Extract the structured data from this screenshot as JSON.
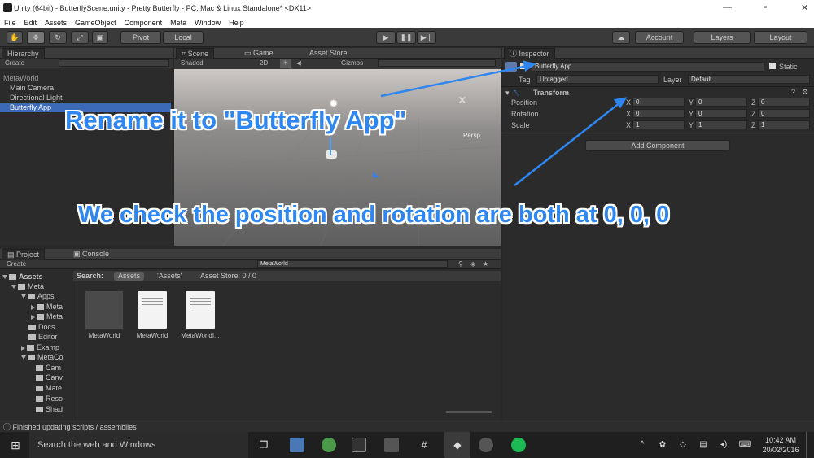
{
  "window": {
    "title": "Unity (64bit) - ButterflyScene.unity - Pretty Butterfly - PC, Mac & Linux Standalone* <DX11>"
  },
  "menu": [
    "File",
    "Edit",
    "Assets",
    "GameObject",
    "Component",
    "Meta",
    "Window",
    "Help"
  ],
  "toolbar": {
    "pivot": "Pivot",
    "local": "Local",
    "account": "Account",
    "layers": "Layers",
    "layout": "Layout"
  },
  "hierarchy": {
    "tab": "Hierarchy",
    "create": "Create",
    "items": [
      {
        "label": "MetaWorld",
        "selected": false
      },
      {
        "label": "Main Camera",
        "selected": false
      },
      {
        "label": "Directional Light",
        "selected": false
      },
      {
        "label": "Butterfly App",
        "selected": true
      }
    ]
  },
  "scene": {
    "tab": "Scene",
    "game_tab": "Game",
    "store_tab": "Asset Store",
    "shaded": "Shaded",
    "mode2d": "2D",
    "gizmos": "Gizmos",
    "persp": "Persp"
  },
  "inspector": {
    "tab": "Inspector",
    "object_name": "Butterfly App",
    "static": "Static",
    "tag_label": "Tag",
    "tag_value": "Untagged",
    "layer_label": "Layer",
    "layer_value": "Default",
    "component": "Transform",
    "rows": [
      {
        "label": "Position",
        "x": "0",
        "y": "0",
        "z": "0"
      },
      {
        "label": "Rotation",
        "x": "0",
        "y": "0",
        "z": "0"
      },
      {
        "label": "Scale",
        "x": "1",
        "y": "1",
        "z": "1"
      }
    ],
    "add_component": "Add Component"
  },
  "project": {
    "tab": "Project",
    "console_tab": "Console",
    "create": "Create",
    "search_value": "MetaWorld",
    "search_label": "Search:",
    "scope_assets": "Assets",
    "scope_quoted": "'Assets'",
    "asset_store": "Asset Store: 0 / 0",
    "tree": [
      "Assets",
      "Meta",
      "Apps",
      "Meta",
      "Meta",
      "Docs",
      "Editor",
      "Examp",
      "MetaCo",
      "Cam",
      "Canv",
      "Mate",
      "Reso",
      "Shad"
    ],
    "assets": [
      {
        "name": "MetaWorld",
        "type": "folder"
      },
      {
        "name": "MetaWorld",
        "type": "doc"
      },
      {
        "name": "MetaWorldI...",
        "type": "doc"
      }
    ]
  },
  "annotations": {
    "rename": "Rename it to \"Butterfly App\"",
    "check": "We check the position and rotation are both at 0, 0, 0"
  },
  "status": "Finished updating scripts / assemblies",
  "taskbar": {
    "search": "Search the web and Windows",
    "time": "10:42 AM",
    "date": "20/02/2016"
  },
  "colors": {
    "accent": "#2e86f0",
    "selection": "#3d6ab8",
    "scene_sky": "#c9c4c0"
  }
}
